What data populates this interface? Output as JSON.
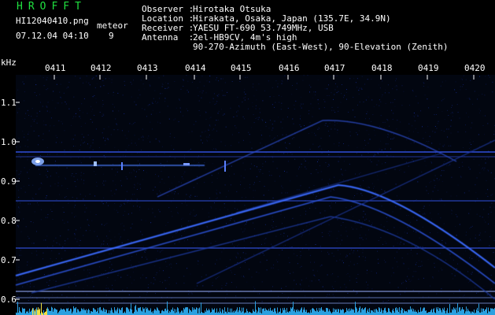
{
  "header": {
    "logo": "HROFFT",
    "filename": "HI12040410.png",
    "datetime": "07.12.04 04:10",
    "meteor_label": "meteor",
    "meteor_count": "9",
    "observer_key": "Observer :",
    "observer_val": "Hirotaka Otsuka",
    "location_key": "Location :",
    "location_val": "Hirakata, Osaka, Japan (135.7E, 34.9N)",
    "receiver_key": "Receiver :",
    "receiver_val": "YAESU FT-690 53.749MHz, USB",
    "antenna_key": "Antenna  :",
    "antenna_val": "2el-HB9CV, 4m's high",
    "antenna_line2": "90-270-Azimuth (East-West), 90-Elevation (Zenith)"
  },
  "axis": {
    "unit": "kHz",
    "time_ticks": [
      "0411",
      "0412",
      "0413",
      "0414",
      "0415",
      "0416",
      "0417",
      "0418",
      "0419",
      "0420"
    ],
    "freq_ticks": [
      "1.1",
      "1.0",
      "0.9",
      "0.8",
      "0.7",
      "0.6"
    ]
  },
  "colors": {
    "background": "#000000",
    "spectrogram": "#0a1a6a",
    "trace": "#3a6aff",
    "logo": "#20e040",
    "noise_floor": "#2aa0e0"
  }
}
